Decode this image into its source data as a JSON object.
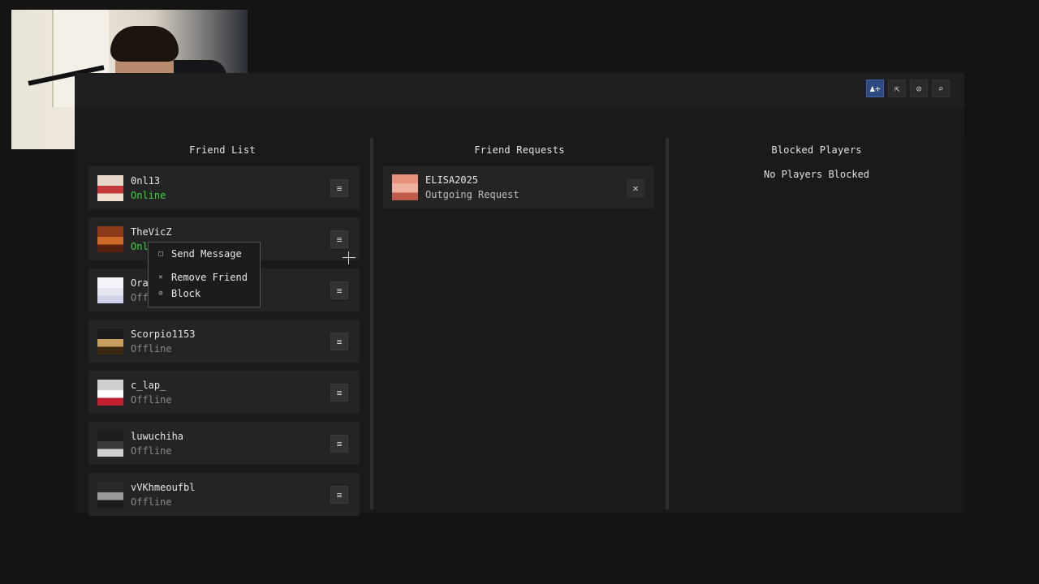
{
  "header": {
    "actions": [
      {
        "icon": "add-friend-icon",
        "glyph": "♟+",
        "active": true
      },
      {
        "icon": "share-icon",
        "glyph": "⇱",
        "active": false
      },
      {
        "icon": "block-icon",
        "glyph": "⊘",
        "active": false
      },
      {
        "icon": "search-icon",
        "glyph": "⌕",
        "active": false
      }
    ]
  },
  "columns": {
    "friends_title": "Friend List",
    "requests_title": "Friend Requests",
    "blocked_title": "Blocked Players"
  },
  "friends": [
    {
      "name": "0nl13",
      "status": "Online",
      "online": true,
      "avatar_colors": [
        "#e8d6c8",
        "#c43a3a",
        "#f0e0d0"
      ]
    },
    {
      "name": "TheVicZ",
      "status": "Online",
      "online": true,
      "avatar_colors": [
        "#8b3a1a",
        "#d06a2a",
        "#5a2010"
      ]
    },
    {
      "name": "Ora",
      "status": "Offline",
      "online": false,
      "avatar_colors": [
        "#f4f4f8",
        "#e6e6f0",
        "#cfd2e8"
      ]
    },
    {
      "name": "Scorpio1153",
      "status": "Offline",
      "online": false,
      "avatar_colors": [
        "#1c1c1c",
        "#c8a060",
        "#3a2a10"
      ]
    },
    {
      "name": "c_lap_",
      "status": "Offline",
      "online": false,
      "avatar_colors": [
        "#cfcfcf",
        "#ffffff",
        "#c02030"
      ]
    },
    {
      "name": "luwuchiha",
      "status": "Offline",
      "online": false,
      "avatar_colors": [
        "#1e1e1e",
        "#3a3a3a",
        "#cfcfcf"
      ]
    },
    {
      "name": "vVKhmeoufbl",
      "status": "Offline",
      "online": false,
      "avatar_colors": [
        "#2a2a2a",
        "#9a9a9a",
        "#1a1a1a"
      ]
    }
  ],
  "requests": [
    {
      "name": "ELISA2025",
      "status": "Outgoing Request",
      "avatar_colors": [
        "#e8907a",
        "#f0b0a0",
        "#c05a48"
      ],
      "close_glyph": "✕"
    }
  ],
  "blocked": {
    "empty_text": "No Players Blocked"
  },
  "context_menu": {
    "items": [
      {
        "icon": "message-icon",
        "glyph": "□",
        "label": "Send Message"
      },
      {
        "icon": "close-icon",
        "glyph": "✕",
        "label": "Remove Friend"
      },
      {
        "icon": "block-icon",
        "glyph": "⊘",
        "label": "Block"
      }
    ]
  },
  "menu_glyph": "≡"
}
